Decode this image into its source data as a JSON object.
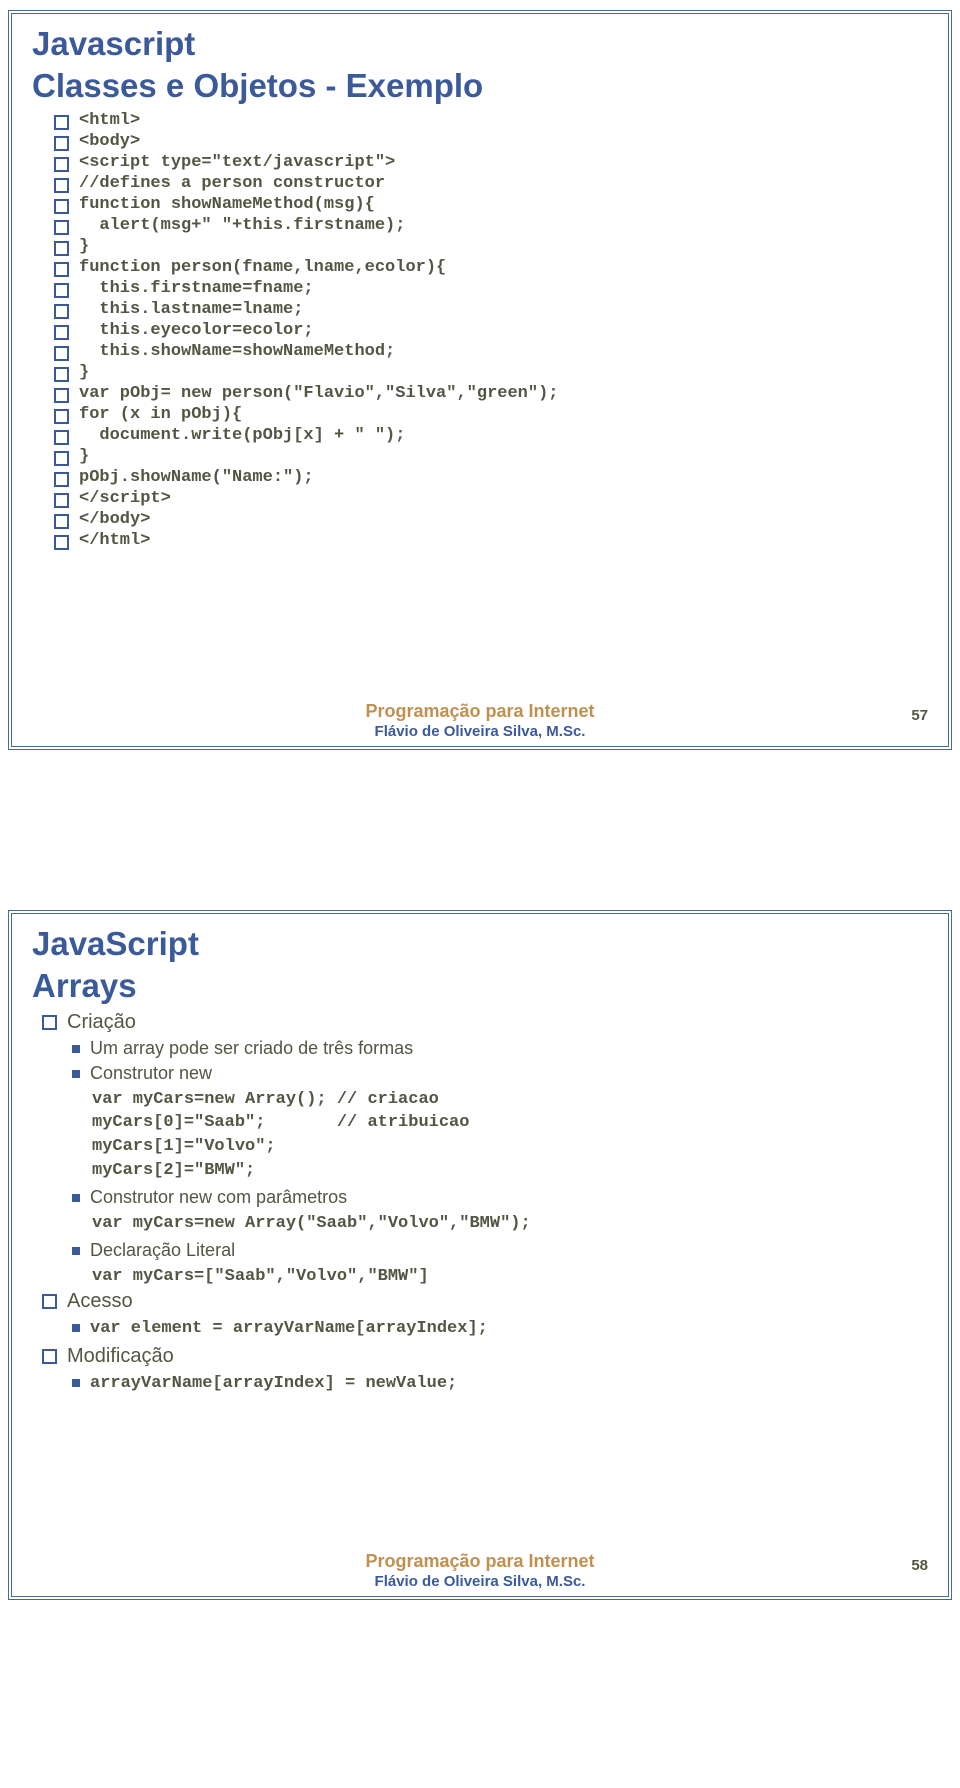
{
  "slide1": {
    "title1": "Javascript",
    "title2": "Classes e Objetos - Exemplo",
    "lines": [
      "<html>",
      "<body>",
      "<script type=\"text/javascript\">",
      "//defines a person constructor",
      "function showNameMethod(msg){",
      "  alert(msg+\" \"+this.firstname);",
      "}",
      "function person(fname,lname,ecolor){",
      "  this.firstname=fname;",
      "  this.lastname=lname;",
      "  this.eyecolor=ecolor;",
      "  this.showName=showNameMethod;",
      "}",
      "var pObj= new person(\"Flavio\",\"Silva\",\"green\");",
      "for (x in pObj){",
      "  document.write(pObj[x] + \" \");",
      "}",
      "pObj.showName(\"Name:\");",
      "</script>",
      "</body>",
      "</html>"
    ],
    "footer_title": "Programação para Internet",
    "footer_sub": "Flávio de Oliveira Silva, M.Sc.",
    "page": "57"
  },
  "slide2": {
    "title1": "JavaScript",
    "title2": "Arrays",
    "main_bullets": [
      {
        "label": "Criação",
        "subs": [
          {
            "text": "Um array pode ser criado de três formas",
            "code": []
          },
          {
            "text": "Construtor new",
            "code": [
              "var myCars=new Array(); // criacao",
              "myCars[0]=\"Saab\";       // atribuicao",
              "myCars[1]=\"Volvo\";",
              "myCars[2]=\"BMW\";"
            ]
          },
          {
            "text": "Construtor new com parâmetros",
            "code": [
              "var myCars=new Array(\"Saab\",\"Volvo\",\"BMW\");"
            ]
          },
          {
            "text": "Declaração Literal",
            "code": [
              "var myCars=[\"Saab\",\"Volvo\",\"BMW\"]"
            ]
          }
        ]
      },
      {
        "label": "Acesso",
        "subs": [
          {
            "text": "",
            "code": [
              "var element = arrayVarName[arrayIndex];"
            ]
          }
        ]
      },
      {
        "label": "Modificação",
        "subs": [
          {
            "text": "",
            "code": [
              "arrayVarName[arrayIndex] = newValue;"
            ]
          }
        ]
      }
    ],
    "footer_title": "Programação para Internet",
    "footer_sub": "Flávio de Oliveira Silva, M.Sc.",
    "page": "58"
  }
}
